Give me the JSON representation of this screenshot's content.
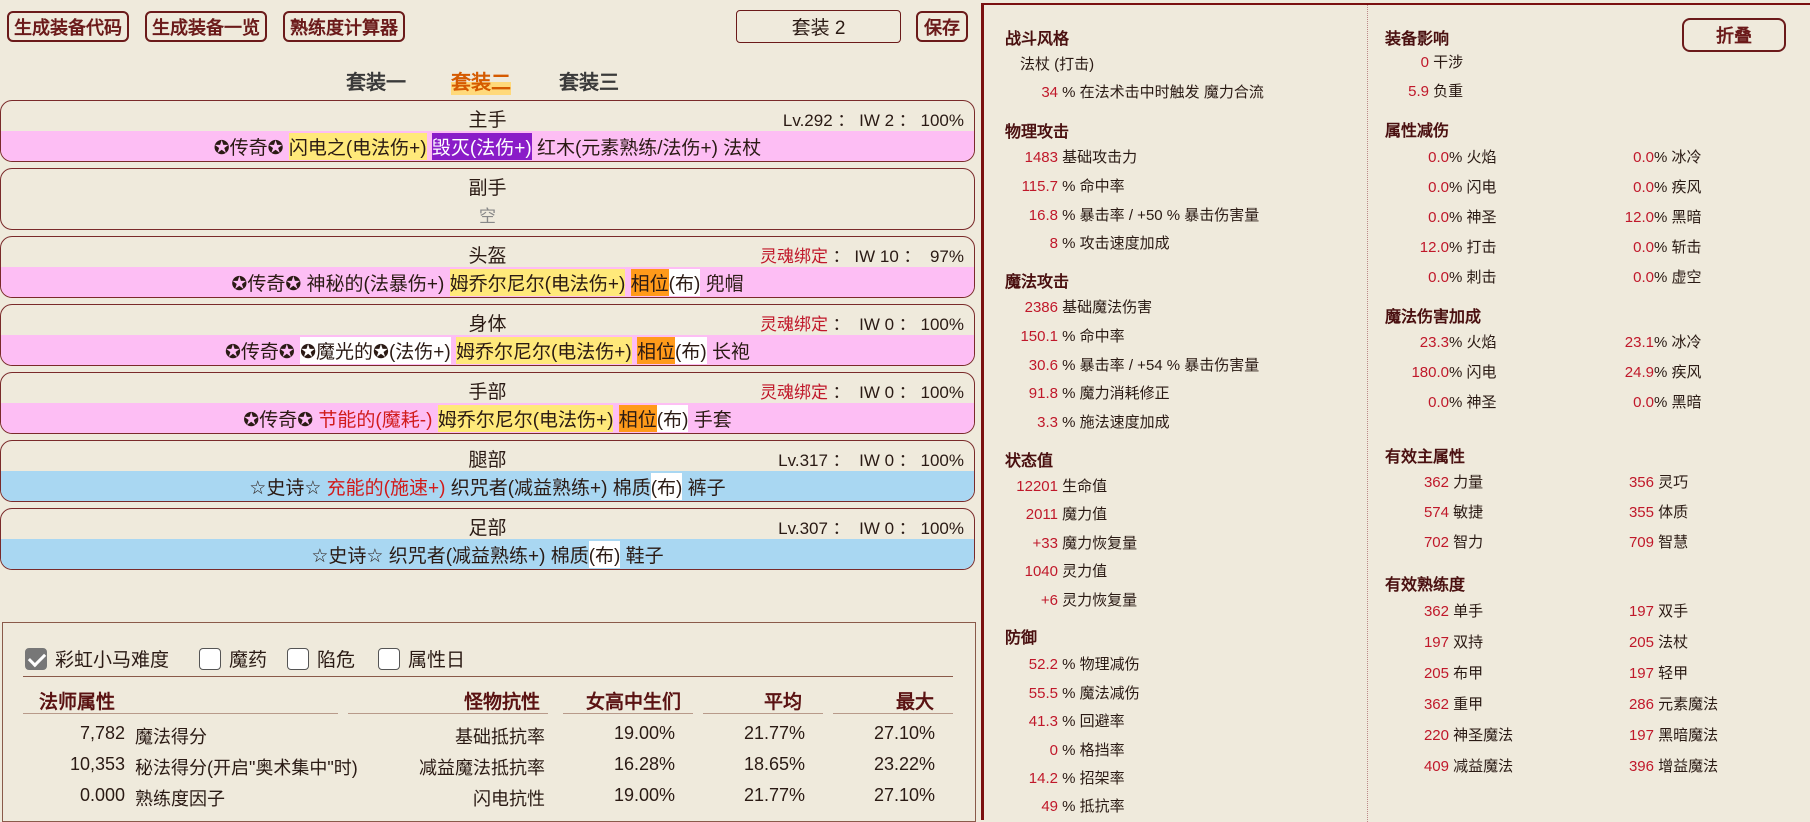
{
  "toolbar": {
    "gen_code": "生成装备代码",
    "gen_list": "生成装备一览",
    "proficiency_calc": "熟练度计算器",
    "set_name": "套装 2",
    "save": "保存"
  },
  "set_tabs": [
    "套装一",
    "套装二",
    "套装三"
  ],
  "slots": [
    {
      "name": "主手",
      "meta": "Lv.292 ： IW 2 ： 100%",
      "soul": ""
    },
    {
      "name": "副手",
      "meta": "",
      "soul": "",
      "empty": "空"
    },
    {
      "name": "头盔",
      "meta": " ： IW 10 ：  97%",
      "soul": "灵魂绑定"
    },
    {
      "name": "身体",
      "meta": " ：  IW 0 ： 100%",
      "soul": "灵魂绑定"
    },
    {
      "name": "手部",
      "meta": " ：  IW 0 ： 100%",
      "soul": "灵魂绑定"
    },
    {
      "name": "腿部",
      "meta": "Lv.317 ：  IW 0 ： 100%",
      "soul": ""
    },
    {
      "name": "足部",
      "meta": "Lv.307 ：  IW 0 ： 100%",
      "soul": ""
    }
  ],
  "items": {
    "main": {
      "rarity": "✪传奇✪",
      "p1": "闪电之(电法伤+)",
      "p2": "毁灭(法伤+)",
      "base": "红木(元素熟练/法伤+) 法杖"
    },
    "helm": {
      "rarity": "✪传奇✪",
      "p1": "神秘的(法暴伤+)",
      "p2": "姆乔尔尼尔(电法伤+)",
      "p3": "相位",
      "mat": "(布)",
      "type": "兜帽"
    },
    "body": {
      "rarity": "✪传奇✪",
      "p0": "✪魔光的✪(法伤+)",
      "p1": "姆乔尔尼尔(电法伤+)",
      "p2": "相位",
      "mat": "(布)",
      "type": "长袍"
    },
    "hands": {
      "rarity": "✪传奇✪",
      "p0": "节能的(魔耗-)",
      "p1": "姆乔尔尼尔(电法伤+)",
      "p2": "相位",
      "mat": "(布)",
      "type": "手套"
    },
    "legs": {
      "rarity": "☆史诗☆",
      "p0": "充能的(施速+)",
      "p1": "织咒者(减益熟练+) 棉质",
      "mat": "(布)",
      "type": "裤子"
    },
    "feet": {
      "rarity": "☆史诗☆",
      "p1": "织咒者(减益熟练+) 棉质",
      "mat": "(布)",
      "type": "鞋子"
    }
  },
  "options": [
    {
      "label": "彩虹小马难度",
      "checked": true
    },
    {
      "label": "魔药",
      "checked": false
    },
    {
      "label": "陷危",
      "checked": false
    },
    {
      "label": "属性日",
      "checked": false
    }
  ],
  "table": {
    "headers": [
      "法师属性",
      "怪物抗性",
      "女高中生们",
      "平均",
      "最大"
    ],
    "rows": [
      {
        "val": "7,782",
        "name": "魔法得分",
        "res": "基础抵抗率",
        "a": "19.00%",
        "b": "21.77%",
        "c": "27.10%"
      },
      {
        "val": "10,353",
        "name": "秘法得分(开启\"奥术集中\"时)",
        "res": "减益魔法抵抗率",
        "a": "16.28%",
        "b": "18.65%",
        "c": "23.22%"
      },
      {
        "val": "0.000",
        "name": "熟练度因子",
        "res": "闪电抗性",
        "a": "19.00%",
        "b": "21.77%",
        "c": "27.10%"
      }
    ]
  },
  "stats": {
    "fold": "折叠",
    "combat_style": {
      "title": "战斗风格",
      "style": "法杖 (打击)",
      "proc_val": "34",
      "proc_label": "% 在法术击中时触发 魔力合流"
    },
    "phys": {
      "title": "物理攻击",
      "rows": [
        {
          "v": "1483",
          "l": "基础攻击力"
        },
        {
          "v": "115.7",
          "l": "% 命中率"
        },
        {
          "v": "16.8",
          "l": "% 暴击率 / +50 % 暴击伤害量"
        },
        {
          "v": "8",
          "l": "% 攻击速度加成"
        }
      ]
    },
    "magic": {
      "title": "魔法攻击",
      "rows": [
        {
          "v": "2386",
          "l": "基础魔法伤害"
        },
        {
          "v": "150.1",
          "l": "% 命中率"
        },
        {
          "v": "30.6",
          "l": "% 暴击率 / +54 % 暴击伤害量"
        },
        {
          "v": "91.8",
          "l": "% 魔力消耗修正"
        },
        {
          "v": "3.3",
          "l": "% 施法速度加成"
        }
      ]
    },
    "status": {
      "title": "状态值",
      "rows": [
        {
          "v": "12201",
          "l": "生命值"
        },
        {
          "v": "2011",
          "l": "魔力值"
        },
        {
          "v": "+33",
          "l": "魔力恢复量"
        },
        {
          "v": "1040",
          "l": "灵力值"
        },
        {
          "v": "+6",
          "l": "灵力恢复量"
        }
      ]
    },
    "defense": {
      "title": "防御",
      "rows": [
        {
          "v": "52.2",
          "l": "% 物理减伤"
        },
        {
          "v": "55.5",
          "l": "% 魔法减伤"
        },
        {
          "v": "41.3",
          "l": "% 回避率"
        },
        {
          "v": "0",
          "l": "% 格挡率"
        },
        {
          "v": "14.2",
          "l": "% 招架率"
        },
        {
          "v": "49",
          "l": "% 抵抗率"
        }
      ]
    },
    "equip_effect": {
      "title": "装备影响",
      "rows": [
        {
          "v": "0",
          "l": "干涉"
        },
        {
          "v": "5.9",
          "l": "负重"
        }
      ]
    },
    "attr_reduce": {
      "title": "属性减伤",
      "rows": [
        {
          "v1": "0.0",
          "l1": "火焰",
          "v2": "0.0",
          "l2": "冰冷"
        },
        {
          "v1": "0.0",
          "l1": "闪电",
          "v2": "0.0",
          "l2": "疾风"
        },
        {
          "v1": "0.0",
          "l1": "神圣",
          "v2": "12.0",
          "l2": "黑暗"
        },
        {
          "v1": "12.0",
          "l1": "打击",
          "v2": "0.0",
          "l2": "斩击"
        },
        {
          "v1": "0.0",
          "l1": "刺击",
          "v2": "0.0",
          "l2": "虚空"
        }
      ]
    },
    "magic_bonus": {
      "title": "魔法伤害加成",
      "rows": [
        {
          "v1": "23.3",
          "l1": "火焰",
          "v2": "23.1",
          "l2": "冰冷"
        },
        {
          "v1": "180.0",
          "l1": "闪电",
          "v2": "24.9",
          "l2": "疾风"
        },
        {
          "v1": "0.0",
          "l1": "神圣",
          "v2": "0.0",
          "l2": "黑暗"
        }
      ]
    },
    "primary": {
      "title": "有效主属性",
      "rows": [
        {
          "v1": "362",
          "l1": "力量",
          "v2": "356",
          "l2": "灵巧"
        },
        {
          "v1": "574",
          "l1": "敏捷",
          "v2": "355",
          "l2": "体质"
        },
        {
          "v1": "702",
          "l1": "智力",
          "v2": "709",
          "l2": "智慧"
        }
      ]
    },
    "prof": {
      "title": "有效熟练度",
      "rows": [
        {
          "v1": "362",
          "l1": "单手",
          "v2": "197",
          "l2": "双手"
        },
        {
          "v1": "197",
          "l1": "双持",
          "v2": "205",
          "l2": "法杖"
        },
        {
          "v1": "205",
          "l1": "布甲",
          "v2": "197",
          "l2": "轻甲"
        },
        {
          "v1": "362",
          "l1": "重甲",
          "v2": "286",
          "l2": "元素魔法"
        },
        {
          "v1": "220",
          "l1": "神圣魔法",
          "v2": "197",
          "l2": "黑暗魔法"
        },
        {
          "v1": "409",
          "l1": "减益魔法",
          "v2": "396",
          "l2": "增益魔法"
        }
      ]
    }
  }
}
